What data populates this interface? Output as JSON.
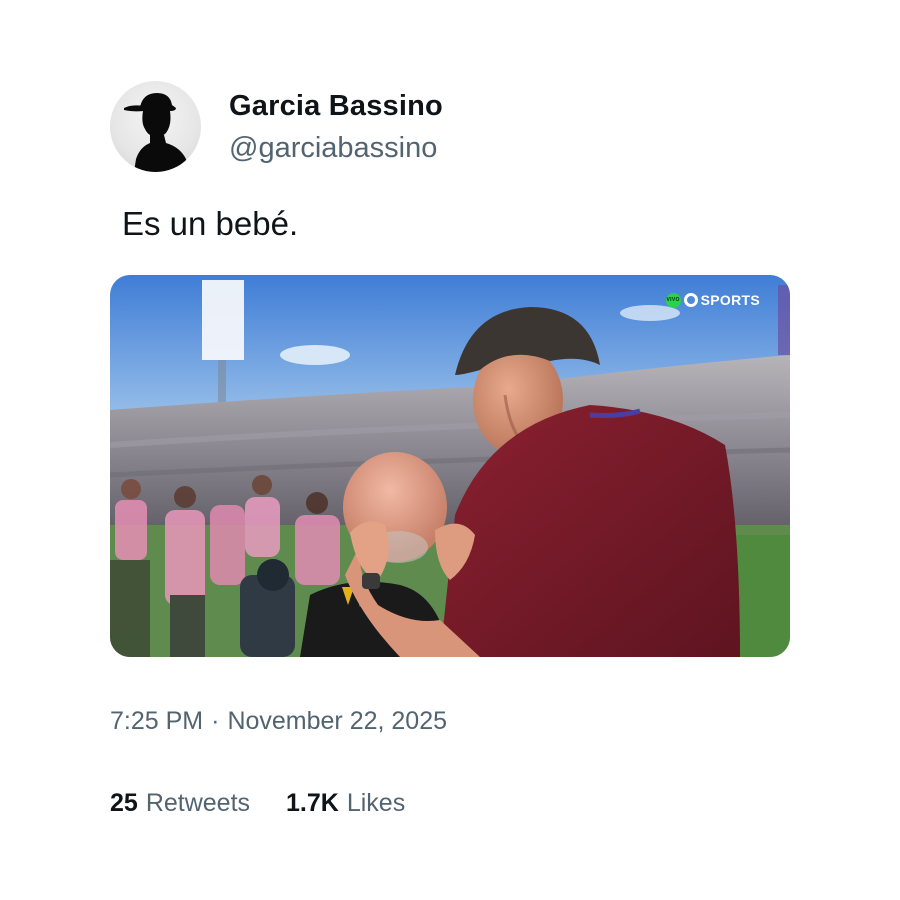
{
  "author": {
    "display_name": "Garcia Bassino",
    "handle": "@garciabassino",
    "avatar_icon": "silhouette-with-cap"
  },
  "tweet": {
    "text": "Es un bebé.",
    "time": "7:25 PM",
    "separator": "·",
    "date": "November 22, 2025"
  },
  "media": {
    "watermark_badge": "VIVO",
    "watermark_brand": "SPORTS"
  },
  "stats": {
    "retweets_count": "25",
    "retweets_label": "Retweets",
    "likes_count": "1.7K",
    "likes_label": "Likes"
  },
  "colors": {
    "primary_text": "#0f1419",
    "secondary_text": "#536471",
    "background": "#ffffff"
  }
}
